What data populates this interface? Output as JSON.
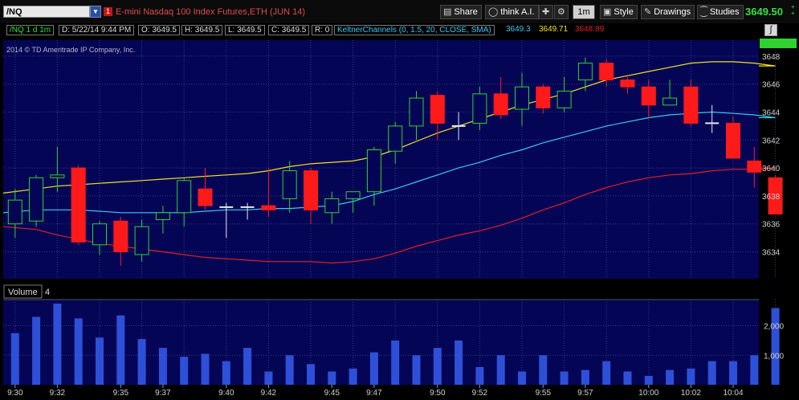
{
  "toolbar": {
    "symbol": "/NQ",
    "link_badge": "1",
    "description": "E-mini Nasdaq 100 Index Futures,ETH (JUN 14)",
    "buttons": [
      {
        "name": "share-button",
        "icon": "share-icon",
        "label": "Share"
      },
      {
        "name": "think-ai-button",
        "icon": "think-ai-icon",
        "label": "think A.I."
      },
      {
        "name": "cursor-tool-button",
        "icon": "cursor-icon",
        "label": ""
      },
      {
        "name": "wrench-button",
        "icon": "wrench-icon",
        "label": ""
      },
      {
        "name": "timeframe-button",
        "icon": "",
        "label": "1m"
      },
      {
        "name": "style-button",
        "icon": "style-icon",
        "label": "Style"
      },
      {
        "name": "drawings-button",
        "icon": "pencil-icon",
        "label": "Drawings"
      },
      {
        "name": "studies-button",
        "icon": "flask-icon",
        "label": "Studies"
      }
    ],
    "last_price": "3649.50",
    "change_top": "+",
    "change_bottom": "+"
  },
  "infobar": {
    "symbol_period": "/NQ 1 d 1m",
    "date": "D: 5/22/14 9:44 PM",
    "open": "O: 3649.5",
    "high": "H: 3649.5",
    "low": "L: 3649.5",
    "close": "C: 3649.5",
    "range": "R: 0",
    "study": "KeltnerChannels (0, 1.5, 20, CLOSE, SMA)",
    "kc_mid": "3649.3",
    "kc_upper": "3649.71",
    "kc_lower": "3648.89"
  },
  "copyright": "2014 © TD Ameritrade IP Company, Inc.",
  "volume_label": "Volume",
  "volume_value": "4",
  "colors": {
    "background": "#050556",
    "up_candle": "#2fd22f",
    "down_candle": "#ff1a1a",
    "upper_band": "#f0e020",
    "middle_band": "#3cc8ee",
    "lower_band": "#e02020",
    "volume_bar": "#2e50d8",
    "grid": "#3a3a88"
  },
  "chart_data": {
    "type": "candlestick",
    "price_axis": {
      "ticks": [
        3634,
        3636,
        3638,
        3640,
        3642,
        3644,
        3646,
        3648
      ],
      "ylim": [
        3632,
        3649.5
      ]
    },
    "volume_axis": {
      "ticks": [
        1000,
        2000
      ],
      "labels": [
        "1,000",
        "2,000"
      ],
      "ylim": [
        0,
        2750
      ]
    },
    "time_labels": [
      "9:30",
      "9:32",
      "9:35",
      "9:37",
      "9:40",
      "9:42",
      "9:45",
      "9:47",
      "9:50",
      "9:52",
      "9:55",
      "9:57",
      "10:00",
      "10:02",
      "10:04"
    ],
    "candles": [
      {
        "t": "9:30",
        "o": 3636.0,
        "h": 3638.5,
        "l": 3635.0,
        "c": 3637.7,
        "v": 1750
      },
      {
        "t": "9:31",
        "o": 3636.2,
        "h": 3639.5,
        "l": 3635.8,
        "c": 3639.3,
        "v": 2300
      },
      {
        "t": "9:32",
        "o": 3639.3,
        "h": 3641.5,
        "l": 3638.3,
        "c": 3639.5,
        "v": 2750
      },
      {
        "t": "9:33",
        "o": 3640.0,
        "h": 3640.2,
        "l": 3634.5,
        "c": 3634.7,
        "v": 2250
      },
      {
        "t": "9:34",
        "o": 3634.5,
        "h": 3636.2,
        "l": 3633.8,
        "c": 3636.0,
        "v": 1600
      },
      {
        "t": "9:35",
        "o": 3636.2,
        "h": 3636.5,
        "l": 3633.0,
        "c": 3634.0,
        "v": 2350
      },
      {
        "t": "9:36",
        "o": 3633.8,
        "h": 3636.3,
        "l": 3633.3,
        "c": 3635.8,
        "v": 1550
      },
      {
        "t": "9:37",
        "o": 3636.3,
        "h": 3637.3,
        "l": 3635.3,
        "c": 3636.8,
        "v": 1250
      },
      {
        "t": "9:38",
        "o": 3636.8,
        "h": 3639.3,
        "l": 3635.8,
        "c": 3639.1,
        "v": 950
      },
      {
        "t": "9:39",
        "o": 3638.5,
        "h": 3640.0,
        "l": 3637.0,
        "c": 3637.3,
        "v": 1050
      },
      {
        "t": "9:40",
        "o": 3637.2,
        "h": 3637.5,
        "l": 3635.0,
        "c": 3637.2,
        "v": 800
      },
      {
        "t": "9:41",
        "o": 3637.2,
        "h": 3637.5,
        "l": 3636.3,
        "c": 3637.2,
        "v": 1250
      },
      {
        "t": "9:42",
        "o": 3637.3,
        "h": 3640.0,
        "l": 3636.5,
        "c": 3637.0,
        "v": 450
      },
      {
        "t": "9:43",
        "o": 3637.8,
        "h": 3640.5,
        "l": 3636.8,
        "c": 3639.8,
        "v": 1000
      },
      {
        "t": "9:44",
        "o": 3639.8,
        "h": 3640.0,
        "l": 3636.0,
        "c": 3637.0,
        "v": 700
      },
      {
        "t": "9:45",
        "o": 3636.8,
        "h": 3638.3,
        "l": 3636.0,
        "c": 3637.8,
        "v": 450
      },
      {
        "t": "9:46",
        "o": 3637.8,
        "h": 3638.3,
        "l": 3636.8,
        "c": 3638.3,
        "v": 550
      },
      {
        "t": "9:47",
        "o": 3638.3,
        "h": 3641.5,
        "l": 3637.3,
        "c": 3641.3,
        "v": 1100
      },
      {
        "t": "9:48",
        "o": 3641.2,
        "h": 3643.3,
        "l": 3640.3,
        "c": 3643.0,
        "v": 1500
      },
      {
        "t": "9:49",
        "o": 3643.0,
        "h": 3645.5,
        "l": 3642.0,
        "c": 3645.0,
        "v": 1000
      },
      {
        "t": "9:50",
        "o": 3645.2,
        "h": 3645.5,
        "l": 3642.0,
        "c": 3643.2,
        "v": 1250
      },
      {
        "t": "9:51",
        "o": 3643.0,
        "h": 3644.0,
        "l": 3642.0,
        "c": 3643.0,
        "v": 1500
      },
      {
        "t": "9:52",
        "o": 3643.2,
        "h": 3645.8,
        "l": 3642.7,
        "c": 3645.3,
        "v": 600
      },
      {
        "t": "9:53",
        "o": 3645.3,
        "h": 3646.5,
        "l": 3643.5,
        "c": 3643.8,
        "v": 1000
      },
      {
        "t": "9:54",
        "o": 3644.2,
        "h": 3646.8,
        "l": 3643.0,
        "c": 3645.8,
        "v": 450
      },
      {
        "t": "9:55",
        "o": 3645.8,
        "h": 3646.0,
        "l": 3643.9,
        "c": 3644.3,
        "v": 1000
      },
      {
        "t": "9:56",
        "o": 3644.3,
        "h": 3646.5,
        "l": 3644.0,
        "c": 3645.5,
        "v": 450
      },
      {
        "t": "9:57",
        "o": 3646.3,
        "h": 3647.9,
        "l": 3645.5,
        "c": 3647.5,
        "v": 500
      },
      {
        "t": "9:58",
        "o": 3647.5,
        "h": 3647.8,
        "l": 3645.8,
        "c": 3646.3,
        "v": 800
      },
      {
        "t": "9:59",
        "o": 3646.3,
        "h": 3646.5,
        "l": 3645.3,
        "c": 3645.8,
        "v": 450
      },
      {
        "t": "10:00",
        "o": 3645.8,
        "h": 3646.3,
        "l": 3643.5,
        "c": 3644.5,
        "v": 300
      },
      {
        "t": "10:01",
        "o": 3644.5,
        "h": 3646.3,
        "l": 3644.5,
        "c": 3645.0,
        "v": 500
      },
      {
        "t": "10:02",
        "o": 3645.8,
        "h": 3646.3,
        "l": 3643.0,
        "c": 3643.2,
        "v": 550
      },
      {
        "t": "10:03",
        "o": 3643.2,
        "h": 3644.5,
        "l": 3642.5,
        "c": 3643.2,
        "v": 800
      },
      {
        "t": "10:04",
        "o": 3643.2,
        "h": 3643.7,
        "l": 3640.7,
        "c": 3640.7,
        "v": 800
      },
      {
        "t": "10:05",
        "o": 3640.5,
        "h": 3641.5,
        "l": 3638.6,
        "c": 3639.7,
        "v": 1000
      },
      {
        "t": "10:06",
        "o": 3639.3,
        "h": 3639.5,
        "l": 3636.7,
        "c": 3636.7,
        "v": 2600
      }
    ],
    "keltner_upper": [
      3638.2,
      3638.5,
      3638.7,
      3638.8,
      3638.9,
      3639.0,
      3639.1,
      3639.2,
      3639.3,
      3639.4,
      3639.5,
      3639.6,
      3639.8,
      3640.1,
      3640.3,
      3640.4,
      3640.5,
      3640.8,
      3641.3,
      3641.9,
      3642.5,
      3643.0,
      3643.5,
      3644.0,
      3644.5,
      3644.9,
      3645.3,
      3645.8,
      3646.3,
      3646.6,
      3646.9,
      3647.2,
      3647.5,
      3647.6,
      3647.6,
      3647.5,
      3647.3
    ],
    "keltner_middle": [
      3636.8,
      3637.0,
      3637.0,
      3637.0,
      3636.9,
      3636.8,
      3636.8,
      3636.8,
      3636.8,
      3636.9,
      3637.0,
      3637.0,
      3637.1,
      3637.1,
      3637.2,
      3637.3,
      3637.6,
      3638.1,
      3638.5,
      3639.0,
      3639.5,
      3640.0,
      3640.4,
      3640.9,
      3641.3,
      3641.8,
      3642.2,
      3642.6,
      3643.0,
      3643.3,
      3643.6,
      3643.8,
      3643.9,
      3644.0,
      3643.9,
      3643.8,
      3643.6
    ],
    "keltner_lower": [
      3635.8,
      3635.6,
      3635.2,
      3634.9,
      3634.6,
      3634.4,
      3634.2,
      3634.0,
      3633.8,
      3633.6,
      3633.5,
      3633.4,
      3633.3,
      3633.3,
      3633.3,
      3633.2,
      3633.3,
      3633.5,
      3633.9,
      3634.4,
      3634.8,
      3635.2,
      3635.5,
      3635.9,
      3636.4,
      3637.0,
      3637.5,
      3638.1,
      3638.6,
      3639.0,
      3639.3,
      3639.5,
      3639.6,
      3639.8,
      3639.9,
      3639.9,
      3640.0
    ]
  }
}
